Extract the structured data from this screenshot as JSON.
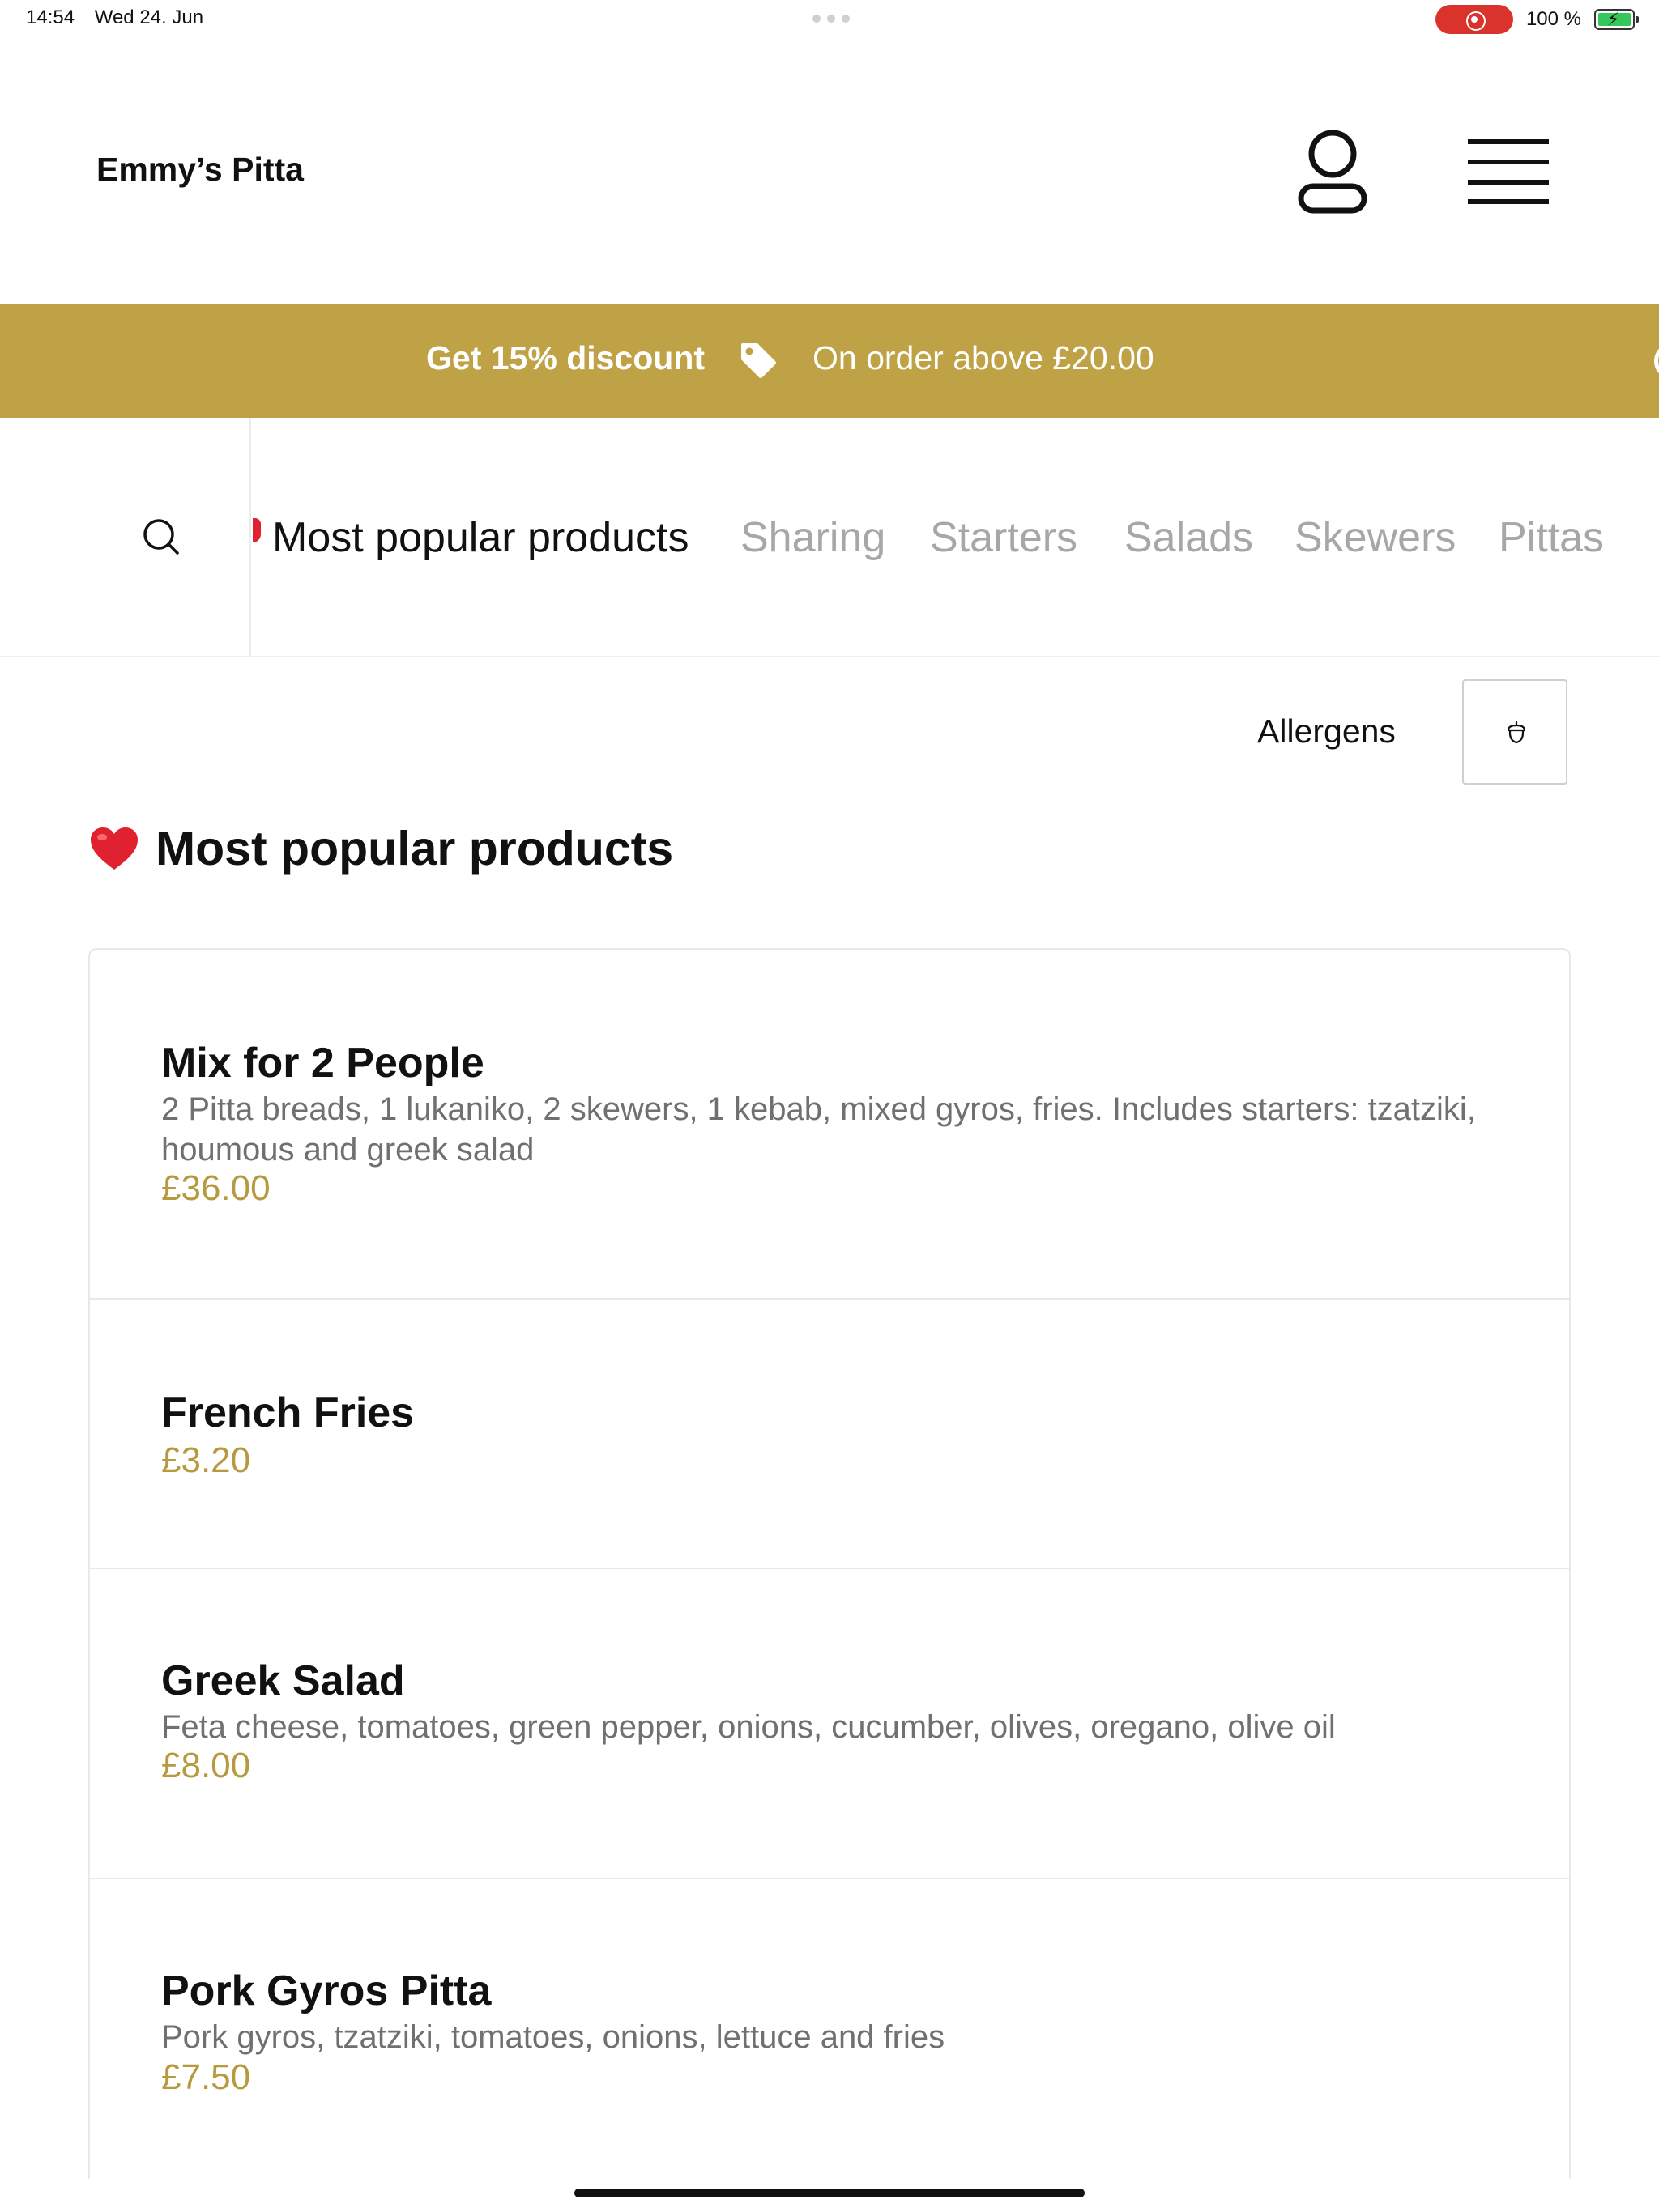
{
  "status_bar": {
    "time": "14:54",
    "date": "Wed 24. Jun",
    "battery": "100 %"
  },
  "header": {
    "brand": "Emmy’s Pitta",
    "icons": [
      "user-icon",
      "menu-icon"
    ]
  },
  "promo": {
    "title": "Get 15% discount",
    "subtitle": "On order above £20.00",
    "icon": "tag-icon",
    "background": "#bfa245"
  },
  "categories": {
    "items": [
      "Most popular products",
      "Sharing",
      "Starters",
      "Salads",
      "Skewers",
      "Pittas"
    ],
    "active": "Most popular products"
  },
  "allergens": {
    "label": "Allergens",
    "icon": "acorn-icon"
  },
  "section": {
    "title": "Most popular products",
    "icon": "heart-icon"
  },
  "products": [
    {
      "name": "Mix for 2 People",
      "description": "2 Pitta breads, 1 lukaniko, 2 skewers, 1 kebab, mixed gyros, fries. Includes starters: tzatziki, houmous and greek salad",
      "price": "£36.00"
    },
    {
      "name": "French Fries",
      "description": "",
      "price": "£3.20"
    },
    {
      "name": "Greek Salad",
      "description": "Feta cheese, tomatoes, green pepper, onions, cucumber, olives, oregano, olive oil",
      "price": "£8.00"
    },
    {
      "name": "Pork Gyros Pitta",
      "description": "Pork gyros, tzatziki, tomatoes, onions, lettuce and fries",
      "price": "£7.50"
    }
  ],
  "colors": {
    "accent": "#bfa245",
    "price": "#b79a3f",
    "muted_text": "#707070",
    "inactive_tab": "#a7a7a7"
  }
}
